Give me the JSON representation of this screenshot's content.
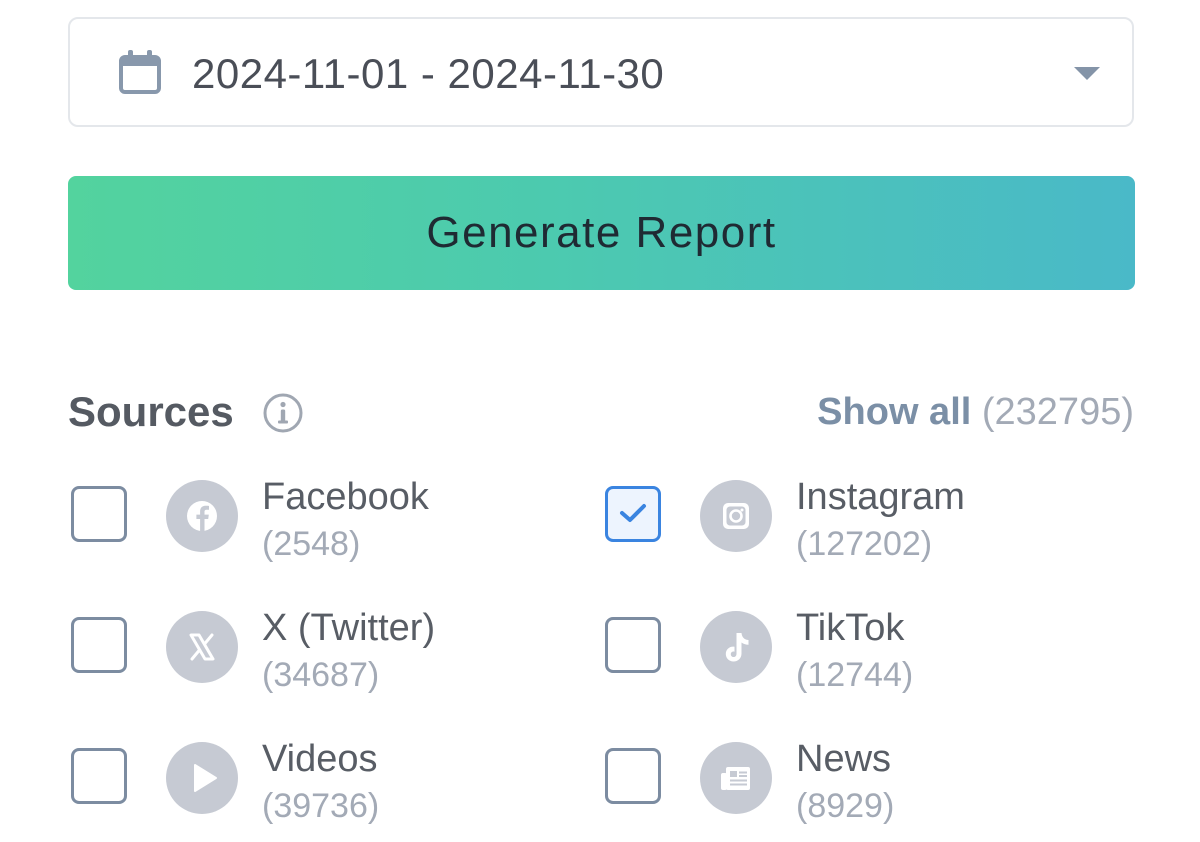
{
  "date_range": {
    "value": "2024-11-01 - 2024-11-30",
    "icon": "calendar-icon",
    "dropdown_icon": "caret-down-icon"
  },
  "generate_button": {
    "label": "Generate Report",
    "gradient_start": "#53d39e",
    "gradient_end": "#4ab9c8"
  },
  "sources": {
    "title": "Sources",
    "info_icon": "info-icon",
    "show_all_label": "Show all",
    "show_all_count": "(232795)",
    "items": [
      {
        "name": "Facebook",
        "count": "(2548)",
        "checked": false,
        "icon": "facebook-icon"
      },
      {
        "name": "Instagram",
        "count": "(127202)",
        "checked": true,
        "icon": "instagram-icon"
      },
      {
        "name": "X (Twitter)",
        "count": "(34687)",
        "checked": false,
        "icon": "x-twitter-icon"
      },
      {
        "name": "TikTok",
        "count": "(12744)",
        "checked": false,
        "icon": "tiktok-icon"
      },
      {
        "name": "Videos",
        "count": "(39736)",
        "checked": false,
        "icon": "play-icon"
      },
      {
        "name": "News",
        "count": "(8929)",
        "checked": false,
        "icon": "newspaper-icon"
      }
    ]
  },
  "colors": {
    "checkbox_border": "#7c8ca1",
    "checkbox_checked": "#3a84e0",
    "icon_circle": "#c6cad3",
    "link": "#7b8fa6"
  }
}
